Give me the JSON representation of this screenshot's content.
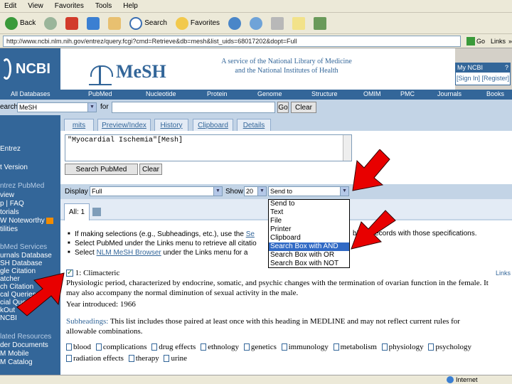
{
  "browser": {
    "menu": [
      "Edit",
      "View",
      "Favorites",
      "Tools",
      "Help"
    ],
    "toolbar": {
      "back": "Back",
      "search": "Search",
      "favorites": "Favorites"
    },
    "address": "http://www.ncbi.nlm.nih.gov/entrez/query.fcgi?cmd=Retrieve&db=mesh&list_uids=68017202&dopt=Full",
    "go_label": "Go",
    "links_label": "Links",
    "chevron": "»"
  },
  "header": {
    "ncbi_logo": "NCBI",
    "mesh_logo": "MeSH",
    "nlm_line1": "A service of the National Library of Medicine",
    "nlm_line2": "and the National Institutes of Health",
    "my_ncbi": "My NCBI",
    "help_mark": "?",
    "sign_in": "[Sign In]",
    "register": "[Register]"
  },
  "nav": [
    "All Databases",
    "PubMed",
    "Nucleotide",
    "Protein",
    "Genome",
    "Structure",
    "OMIM",
    "PMC",
    "Journals",
    "Books"
  ],
  "search": {
    "search_label": "earch",
    "db_value": "MeSH",
    "for_label": "for",
    "go_button": "Go",
    "clear_button": "Clear"
  },
  "tabs": [
    "mits",
    "Preview/Index",
    "History",
    "Clipboard",
    "Details"
  ],
  "query": {
    "text": "\"Myocardial Ischemia\"[Mesh]",
    "search_pubmed": "Search PubMed",
    "clear": "Clear"
  },
  "display": {
    "display_label": "Display",
    "format_value": "Full",
    "show_label": "Show",
    "show_value": "20",
    "send_value": "Send to"
  },
  "send_options": [
    "Send to",
    "Text",
    "File",
    "Printer",
    "Clipboard",
    "Search Box with AND",
    "Search Box with OR",
    "Search Box with NOT"
  ],
  "all_tab": "All: 1",
  "sidebar": [
    {
      "text": "Entrez",
      "head": false
    },
    {
      "text": "t Version",
      "head": false
    },
    {
      "text": "ntrez PubMed",
      "head": true
    },
    {
      "text": "view",
      "head": false
    },
    {
      "text": "p | FAQ",
      "head": false
    },
    {
      "text": "torials",
      "head": false
    },
    {
      "text": "W Noteworthy",
      "head": false
    },
    {
      "text": "tilities",
      "head": false
    },
    {
      "text": "bMed Services",
      "head": true
    },
    {
      "text": "urnals Database",
      "head": false
    },
    {
      "text": "SH Database",
      "head": false
    },
    {
      "text": "gle Citation",
      "head": false
    },
    {
      "text": "atcher",
      "head": false
    },
    {
      "text": "ch Citation",
      "head": false
    },
    {
      "text": "cal Queries",
      "head": false
    },
    {
      "text": "cial Queries",
      "head": false
    },
    {
      "text": "kOut",
      "head": false
    },
    {
      "text": "NCBI",
      "head": false
    },
    {
      "text": "lated Resources",
      "head": true
    },
    {
      "text": "der Documents",
      "head": false
    },
    {
      "text": "M Mobile",
      "head": false
    },
    {
      "text": "M Catalog",
      "head": false
    }
  ],
  "bullets": [
    {
      "pre": "If making selections (e.g., Subheadings, etc.), use the ",
      "link": "Se",
      "post": ""
    },
    {
      "pre": "Select PubMed under the Links menu to retrieve all citatio",
      "link": "",
      "post": ""
    },
    {
      "pre": "Select ",
      "link": "NLM MeSH Browser",
      "post": " under the Links menu for a"
    }
  ],
  "bullet_tail": "bMed records with those specifications.",
  "result": {
    "number": "1:",
    "title": "Climacteric",
    "links": "Links",
    "def1": "Physiologic period, characterized by endocrine, somatic, and psychic changes with the termination of ovarian function in the female. It",
    "def2": "may also accompany the normal diminution of sexual activity in the male.",
    "year": "Year introduced: 1966",
    "sub_label": "Subheadings:",
    "sub_text1": " This list includes those paired at least once with this heading in MEDLINE and may not reflect current rules for",
    "sub_text2": "allowable combinations.",
    "subheadings": [
      "blood",
      "complications",
      "drug effects",
      "ethnology",
      "genetics",
      "immunology",
      "metabolism",
      "physiology",
      "psychology"
    ],
    "subheadings2": [
      "radiation effects",
      "therapy",
      "urine"
    ]
  },
  "status": {
    "zone": "Internet"
  },
  "colors": {
    "ncbi_blue": "#336699",
    "tab_band": "#c3d4e6",
    "highlight": "#316ac5",
    "arrow_red": "#e80000"
  }
}
